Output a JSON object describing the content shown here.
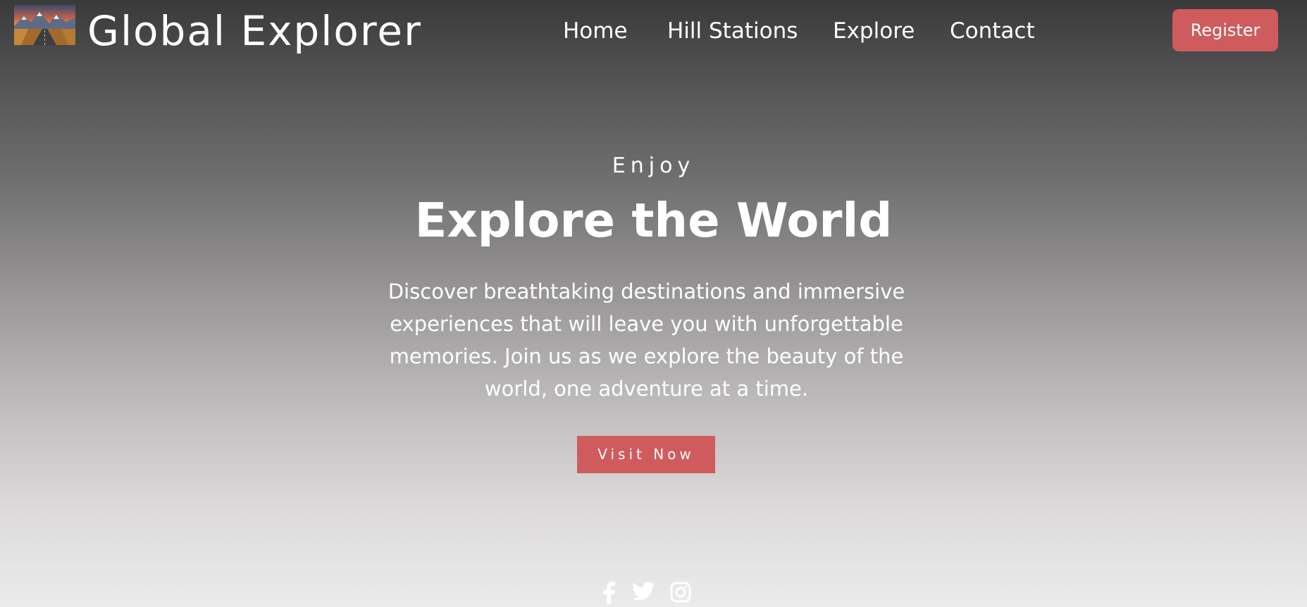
{
  "brand": {
    "name": "Global Explorer",
    "logo": "mountain-road-photo"
  },
  "nav": {
    "items": [
      {
        "label": "Home"
      },
      {
        "label": "Hill Stations"
      },
      {
        "label": "Explore"
      },
      {
        "label": "Contact"
      }
    ],
    "register_label": "Register"
  },
  "hero": {
    "kicker": "Enjoy",
    "title": "Explore the World",
    "description": "Discover breathtaking destinations and immersive experiences that will leave you with unforgettable memories. Join us as we explore the beauty of the world, one adventure at a time.",
    "cta_label": "Visit Now"
  },
  "social": {
    "icons": [
      "facebook-icon",
      "twitter-icon",
      "instagram-icon"
    ]
  },
  "colors": {
    "accent": "#d05b5d",
    "text": "#ffffff",
    "gradient_top": "#3a3a3a",
    "gradient_bottom": "#ecebec"
  }
}
